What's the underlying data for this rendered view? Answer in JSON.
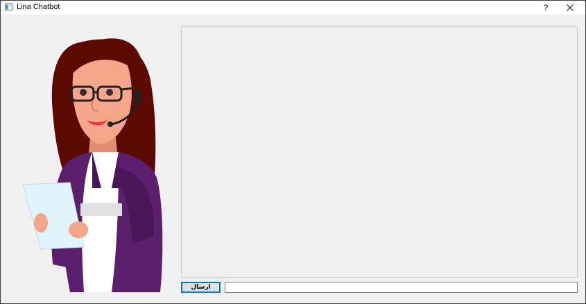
{
  "window": {
    "title": "Lina Chatbot",
    "help_label": "?"
  },
  "chat": {
    "history_text": ""
  },
  "input": {
    "value": "",
    "placeholder": ""
  },
  "toolbar": {
    "send_label": "ارسال"
  },
  "icons": {
    "app": "app-window-icon",
    "help": "help-icon",
    "close": "close-icon"
  },
  "colors": {
    "hair": "#5a0a00",
    "skin": "#f4a58a",
    "jacket": "#5c1f6e",
    "shirt": "#ffffff",
    "paper": "#dff5fb",
    "focus": "#0078d7"
  }
}
